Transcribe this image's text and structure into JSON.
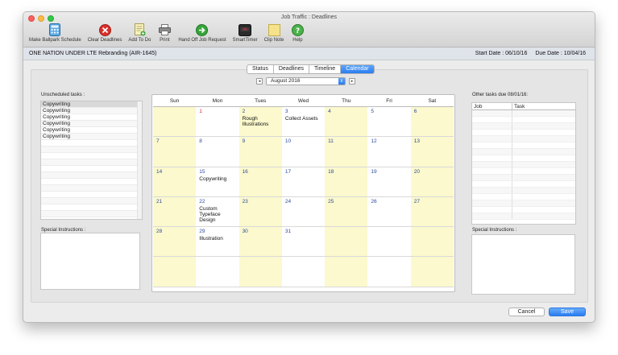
{
  "window": {
    "title": "Job Traffic : Deadlines"
  },
  "toolbar": [
    {
      "label": "Make Ballpark Schedule",
      "icon": "calculator-icon"
    },
    {
      "label": "Clear Deadlines",
      "icon": "clear-icon"
    },
    {
      "label": "Add To Do",
      "icon": "add-note-icon"
    },
    {
      "label": "Print",
      "icon": "printer-icon"
    },
    {
      "label": "Hand Off Job Request",
      "icon": "handoff-icon"
    },
    {
      "label": "SmartTimer",
      "icon": "timer-icon"
    },
    {
      "label": "Clip Note",
      "icon": "clip-note-icon"
    },
    {
      "label": "Help",
      "icon": "help-icon"
    }
  ],
  "job": {
    "name": "ONE NATION UNDER LTE Rebranding (AIR-1645)",
    "start_date": "Start Date : 06/10/16",
    "due_date": "Due Date : 10/04/16"
  },
  "tabs": [
    {
      "label": "Status",
      "active": false
    },
    {
      "label": "Deadlines",
      "active": false
    },
    {
      "label": "Timeline",
      "active": false
    },
    {
      "label": "Calendar",
      "active": true
    }
  ],
  "month": {
    "prev": "◂",
    "next": "▸",
    "selected": "August 2016"
  },
  "unscheduled": {
    "label": "Unscheduled tasks :",
    "items": [
      "Copywriting",
      "Copywriting",
      "Copywriting",
      "Copywriting",
      "Copywriting",
      "Copywriting"
    ]
  },
  "special_left": {
    "label": "Special Instructions :"
  },
  "calendar": {
    "days": [
      "Sun",
      "Mon",
      "Tues",
      "Wed",
      "Thu",
      "Fri",
      "Sat"
    ],
    "weeks": [
      [
        {
          "n": "",
          "e": ""
        },
        {
          "n": "1",
          "e": "",
          "today": true
        },
        {
          "n": "2",
          "e": "Rough Illustrations"
        },
        {
          "n": "3",
          "e": "Collect Assets"
        },
        {
          "n": "4",
          "e": ""
        },
        {
          "n": "5",
          "e": ""
        },
        {
          "n": "6",
          "e": ""
        }
      ],
      [
        {
          "n": "7",
          "e": ""
        },
        {
          "n": "8",
          "e": ""
        },
        {
          "n": "9",
          "e": ""
        },
        {
          "n": "10",
          "e": ""
        },
        {
          "n": "11",
          "e": ""
        },
        {
          "n": "12",
          "e": ""
        },
        {
          "n": "13",
          "e": ""
        }
      ],
      [
        {
          "n": "14",
          "e": ""
        },
        {
          "n": "15",
          "e": "Copywriting"
        },
        {
          "n": "16",
          "e": ""
        },
        {
          "n": "17",
          "e": ""
        },
        {
          "n": "18",
          "e": ""
        },
        {
          "n": "19",
          "e": ""
        },
        {
          "n": "20",
          "e": ""
        }
      ],
      [
        {
          "n": "21",
          "e": ""
        },
        {
          "n": "22",
          "e": "Custom Typeface Design"
        },
        {
          "n": "23",
          "e": ""
        },
        {
          "n": "24",
          "e": ""
        },
        {
          "n": "25",
          "e": ""
        },
        {
          "n": "26",
          "e": ""
        },
        {
          "n": "27",
          "e": ""
        }
      ],
      [
        {
          "n": "28",
          "e": ""
        },
        {
          "n": "29",
          "e": "Illustration"
        },
        {
          "n": "30",
          "e": ""
        },
        {
          "n": "31",
          "e": ""
        },
        {
          "n": "",
          "e": ""
        },
        {
          "n": "",
          "e": ""
        },
        {
          "n": "",
          "e": ""
        }
      ],
      [
        {
          "n": "",
          "e": ""
        },
        {
          "n": "",
          "e": ""
        },
        {
          "n": "",
          "e": ""
        },
        {
          "n": "",
          "e": ""
        },
        {
          "n": "",
          "e": ""
        },
        {
          "n": "",
          "e": ""
        },
        {
          "n": "",
          "e": ""
        }
      ]
    ]
  },
  "other_tasks": {
    "label": "Other tasks due 08/01/16:",
    "col_job": "Job",
    "col_task": "Task"
  },
  "special_right": {
    "label": "Special Instructions :"
  },
  "buttons": {
    "cancel": "Cancel",
    "save": "Save"
  },
  "colors": {
    "accent": "#2a7df1",
    "weekend": "#fbf9cd",
    "today": "#d0262b",
    "day_number": "#2c4b9e"
  }
}
